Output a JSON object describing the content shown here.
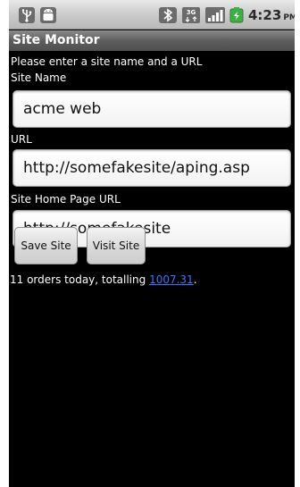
{
  "status_bar": {
    "time": "4:23",
    "ampm": "PM",
    "icons": [
      "usb-icon",
      "android-icon",
      "bluetooth-icon",
      "3g-network-icon",
      "signal-bars-icon",
      "battery-icon"
    ]
  },
  "title_bar": {
    "title": "Site Monitor"
  },
  "form": {
    "instructions": "Please enter a site name and a URL",
    "site_name_label": "Site Name",
    "site_name_value": "acme web",
    "url_label": "URL",
    "url_value": "http://somefakesite/aping.asp",
    "home_page_label": "Site Home Page URL",
    "home_page_value": "http://somefakesite",
    "save_button": "Save Site",
    "visit_button": "Visit Site"
  },
  "summary": {
    "prefix": "11 orders today, totalling",
    "amount": "1007.31",
    "suffix": "."
  },
  "colors": {
    "background": "#000000",
    "link": "#3a73ff",
    "battery": "#3cb043"
  }
}
